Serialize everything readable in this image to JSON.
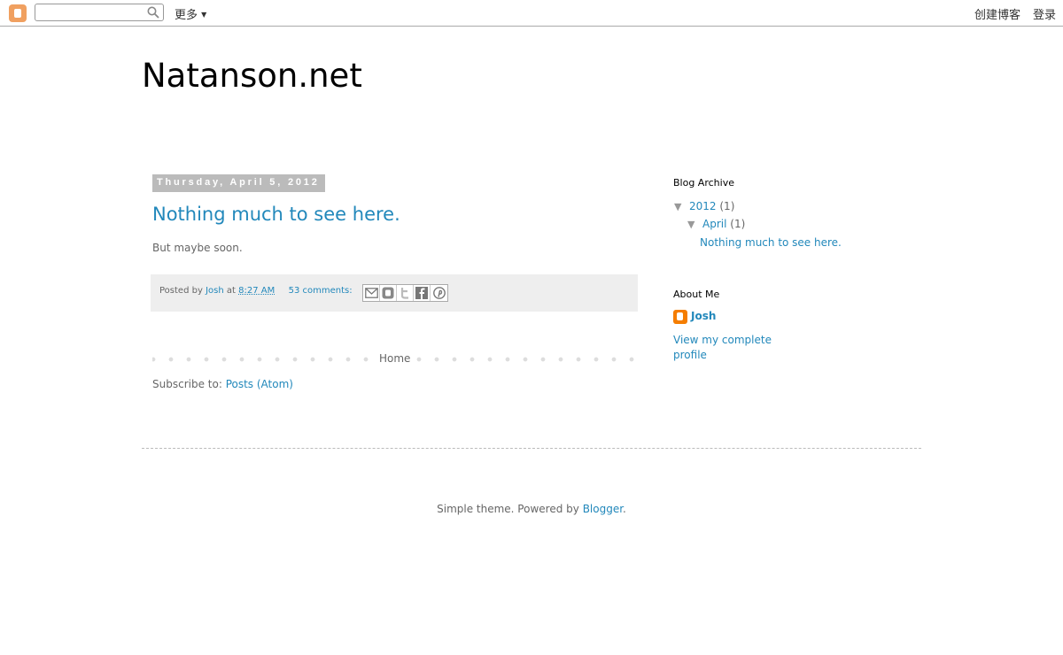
{
  "navbar": {
    "more_label": "更多",
    "create_label": "创建博客",
    "login_label": "登录",
    "search": {
      "value": "",
      "placeholder": ""
    }
  },
  "header": {
    "title": "Natanson.net"
  },
  "post": {
    "date": "Thursday, April 5, 2012",
    "title": "Nothing much to see here.",
    "body": "But maybe soon.",
    "posted_by_prefix": "Posted by",
    "author": "Josh",
    "at_text": "at",
    "time": "8:27 AM",
    "comments": "53 comments:",
    "share_icons": [
      "email-icon",
      "blogthis-icon",
      "twitter-icon",
      "facebook-icon",
      "pinterest-icon"
    ]
  },
  "pager": {
    "home_label": "Home"
  },
  "subscribe": {
    "prefix": "Subscribe to:",
    "link": "Posts (Atom)"
  },
  "sidebar": {
    "archive": {
      "title": "Blog Archive",
      "year": {
        "toggle": "▼",
        "label": "2012",
        "count": "(1)"
      },
      "month": {
        "toggle": "▼",
        "label": "April",
        "count": "(1)"
      },
      "posts": [
        "Nothing much to see here."
      ]
    },
    "about": {
      "title": "About Me",
      "name": "Josh",
      "profile_link": "View my complete profile"
    }
  },
  "footer": {
    "credit_prefix": "Simple theme. Powered by",
    "credit_link": "Blogger",
    "credit_suffix": "."
  },
  "colors": {
    "link": "#2288bb",
    "text": "#666666",
    "date_header_bg": "#bbbbbb",
    "post_footer_bg": "#eeeeee",
    "blogger_orange": "#f57d00"
  }
}
